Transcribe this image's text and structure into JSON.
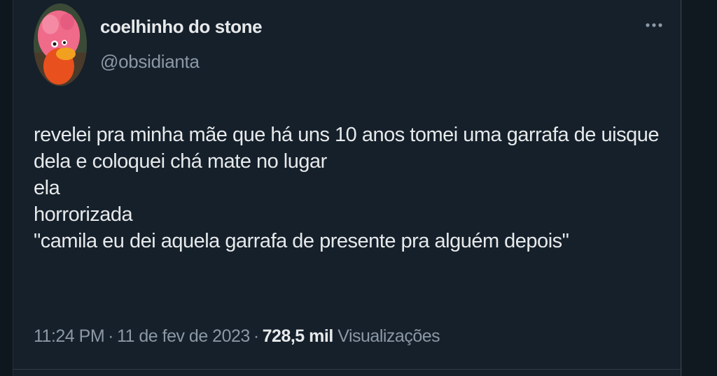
{
  "author": {
    "display_name": "coelhinho do stone",
    "handle": "@obsidianta"
  },
  "tweet": {
    "lines": [
      "revelei pra minha mãe que há uns 10 anos tomei uma garrafa de uisque",
      "dela e coloquei chá mate no lugar",
      "ela",
      "horrorizada",
      "\"camila eu dei aquela garrafa de presente pra alguém depois\""
    ]
  },
  "meta": {
    "time": "11:24 PM",
    "separator": "·",
    "date": "11 de fev de 2023",
    "views_count": "728,5 mil",
    "views_label": "Visualizações"
  },
  "icons": {
    "more": "more-horizontal-icon",
    "avatar": "avatar-image"
  },
  "colors": {
    "background": "#15202b",
    "text_primary": "#e7e9ea",
    "text_secondary": "#8b98a5"
  }
}
